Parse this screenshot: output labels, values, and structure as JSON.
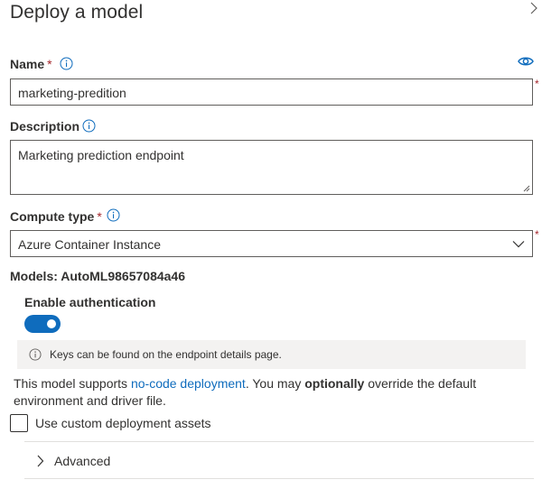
{
  "panel": {
    "title": "Deploy a model"
  },
  "name": {
    "label": "Name",
    "required": "*",
    "value": "marketing-predition"
  },
  "description": {
    "label": "Description",
    "value": "Marketing prediction endpoint"
  },
  "compute": {
    "label": "Compute type",
    "required": "*",
    "value": "Azure Container Instance"
  },
  "models": {
    "text": "Models: AutoML98657084a46"
  },
  "auth": {
    "label": "Enable authentication",
    "enabled": true
  },
  "info_bar": {
    "text": "Keys can be found on the endpoint details page."
  },
  "support": {
    "prefix": "This model supports ",
    "link": "no-code deployment",
    "middle": ". You may ",
    "bold": "optionally",
    "suffix": " override the default environment and driver file."
  },
  "custom_assets": {
    "label": "Use custom deployment assets",
    "checked": false
  },
  "advanced": {
    "label": "Advanced"
  },
  "side_marker": "*",
  "colors": {
    "accent": "#0f6cbd",
    "required": "#a4262c",
    "text": "#323130",
    "info_bg": "#f3f2f1"
  },
  "icons": [
    "chevron-right-icon",
    "info-icon",
    "eye-icon",
    "chevron-down-icon",
    "resize-grip-icon"
  ]
}
